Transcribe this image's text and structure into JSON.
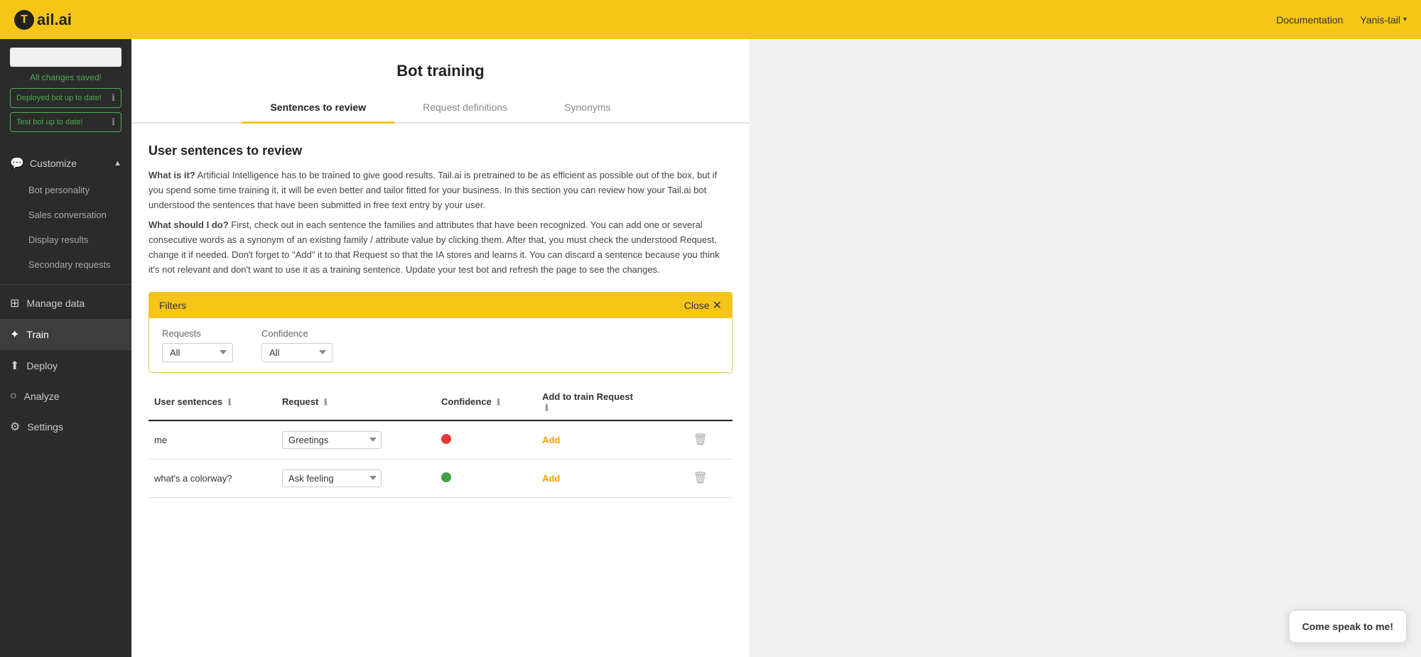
{
  "navbar": {
    "logo_text": "ail.ai",
    "logo_letter": "T",
    "doc_link": "Documentation",
    "user_name": "Yanis-tail",
    "user_chevron": "▾"
  },
  "sidebar": {
    "bot_input_placeholder": "",
    "status_text": "All changes saved!",
    "deployed_badge": "Deployed bot up to date!",
    "test_badge": "Test bot up to date!",
    "customize_label": "Customize",
    "customize_chevron": "▲",
    "sub_items": [
      {
        "label": "Bot personality",
        "active": false
      },
      {
        "label": "Sales conversation",
        "active": false
      },
      {
        "label": "Display results",
        "active": false
      },
      {
        "label": "Secondary requests",
        "active": false
      }
    ],
    "nav_items": [
      {
        "label": "Manage data",
        "icon": "⊞",
        "active": false
      },
      {
        "label": "Train",
        "icon": "✦",
        "active": true
      },
      {
        "label": "Deploy",
        "icon": "⬆",
        "active": false
      },
      {
        "label": "Analyze",
        "icon": "○",
        "active": false
      },
      {
        "label": "Settings",
        "icon": "⚙",
        "active": false
      }
    ]
  },
  "main": {
    "title": "Bot training",
    "tabs": [
      {
        "label": "Sentences to review",
        "active": true
      },
      {
        "label": "Request definitions",
        "active": false
      },
      {
        "label": "Synonyms",
        "active": false
      }
    ],
    "section_title": "User sentences to review",
    "info_what_label": "What is it?",
    "info_what_text": " Artificial Intelligence has to be trained to give good results. Tail.ai is pretrained to be as efficient as possible out of the box, but if you spend some time training it, it will be even better and tailor fitted for your business. In this section you can review how your Tail.ai bot understood the sentences that have been submitted in free text entry by your user.",
    "info_what_do_label": "What should I do?",
    "info_what_do_text": " First, check out in each sentence the families and attributes that have been recognized. You can add one or several consecutive words as a synonym of an existing family / attribute value by clicking them. After that, you must check the understood Request, change it if needed. Don't forget to \"Add\" it to that Request so that the IA stores and learns it. You can discard a sentence because you think it's not relevant and don't want to use it as a training sentence. Update your test bot and refresh the page to see the changes.",
    "filters": {
      "header_label": "Filters",
      "close_label": "Close",
      "requests_label": "Requests",
      "requests_value": "All",
      "confidence_label": "Confidence",
      "confidence_value": "All"
    },
    "table": {
      "col_user_sentences": "User sentences",
      "col_request": "Request",
      "col_confidence": "Confidence",
      "col_add": "Add to train Request",
      "rows": [
        {
          "sentence": "me",
          "request": "Greetings",
          "confidence": "red",
          "add_label": "Add"
        },
        {
          "sentence": "what's a colorway?",
          "request": "Ask feeling",
          "confidence": "green",
          "add_label": "Add"
        }
      ]
    }
  },
  "chat_bubble": {
    "label": "Come speak to me!"
  }
}
